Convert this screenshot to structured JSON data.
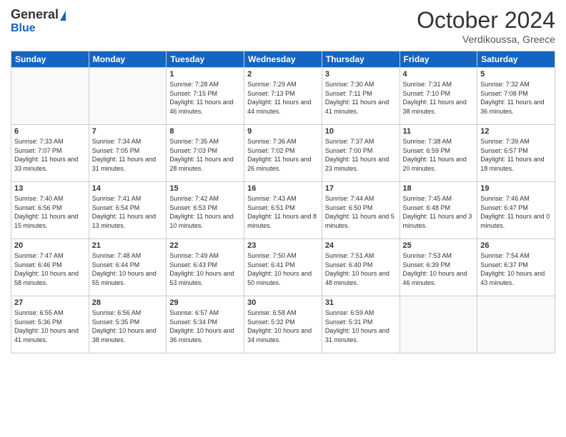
{
  "header": {
    "logo_general": "General",
    "logo_blue": "Blue",
    "month": "October 2024",
    "location": "Verdikoussa, Greece"
  },
  "weekdays": [
    "Sunday",
    "Monday",
    "Tuesday",
    "Wednesday",
    "Thursday",
    "Friday",
    "Saturday"
  ],
  "weeks": [
    [
      {
        "day": "",
        "info": ""
      },
      {
        "day": "",
        "info": ""
      },
      {
        "day": "1",
        "info": "Sunrise: 7:28 AM\nSunset: 7:15 PM\nDaylight: 11 hours and 46 minutes."
      },
      {
        "day": "2",
        "info": "Sunrise: 7:29 AM\nSunset: 7:13 PM\nDaylight: 11 hours and 44 minutes."
      },
      {
        "day": "3",
        "info": "Sunrise: 7:30 AM\nSunset: 7:11 PM\nDaylight: 11 hours and 41 minutes."
      },
      {
        "day": "4",
        "info": "Sunrise: 7:31 AM\nSunset: 7:10 PM\nDaylight: 11 hours and 38 minutes."
      },
      {
        "day": "5",
        "info": "Sunrise: 7:32 AM\nSunset: 7:08 PM\nDaylight: 11 hours and 36 minutes."
      }
    ],
    [
      {
        "day": "6",
        "info": "Sunrise: 7:33 AM\nSunset: 7:07 PM\nDaylight: 11 hours and 33 minutes."
      },
      {
        "day": "7",
        "info": "Sunrise: 7:34 AM\nSunset: 7:05 PM\nDaylight: 11 hours and 31 minutes."
      },
      {
        "day": "8",
        "info": "Sunrise: 7:35 AM\nSunset: 7:03 PM\nDaylight: 11 hours and 28 minutes."
      },
      {
        "day": "9",
        "info": "Sunrise: 7:36 AM\nSunset: 7:02 PM\nDaylight: 11 hours and 26 minutes."
      },
      {
        "day": "10",
        "info": "Sunrise: 7:37 AM\nSunset: 7:00 PM\nDaylight: 11 hours and 23 minutes."
      },
      {
        "day": "11",
        "info": "Sunrise: 7:38 AM\nSunset: 6:59 PM\nDaylight: 11 hours and 20 minutes."
      },
      {
        "day": "12",
        "info": "Sunrise: 7:39 AM\nSunset: 6:57 PM\nDaylight: 11 hours and 18 minutes."
      }
    ],
    [
      {
        "day": "13",
        "info": "Sunrise: 7:40 AM\nSunset: 6:56 PM\nDaylight: 11 hours and 15 minutes."
      },
      {
        "day": "14",
        "info": "Sunrise: 7:41 AM\nSunset: 6:54 PM\nDaylight: 11 hours and 13 minutes."
      },
      {
        "day": "15",
        "info": "Sunrise: 7:42 AM\nSunset: 6:53 PM\nDaylight: 11 hours and 10 minutes."
      },
      {
        "day": "16",
        "info": "Sunrise: 7:43 AM\nSunset: 6:51 PM\nDaylight: 11 hours and 8 minutes."
      },
      {
        "day": "17",
        "info": "Sunrise: 7:44 AM\nSunset: 6:50 PM\nDaylight: 11 hours and 5 minutes."
      },
      {
        "day": "18",
        "info": "Sunrise: 7:45 AM\nSunset: 6:48 PM\nDaylight: 11 hours and 3 minutes."
      },
      {
        "day": "19",
        "info": "Sunrise: 7:46 AM\nSunset: 6:47 PM\nDaylight: 11 hours and 0 minutes."
      }
    ],
    [
      {
        "day": "20",
        "info": "Sunrise: 7:47 AM\nSunset: 6:46 PM\nDaylight: 10 hours and 58 minutes."
      },
      {
        "day": "21",
        "info": "Sunrise: 7:48 AM\nSunset: 6:44 PM\nDaylight: 10 hours and 55 minutes."
      },
      {
        "day": "22",
        "info": "Sunrise: 7:49 AM\nSunset: 6:43 PM\nDaylight: 10 hours and 53 minutes."
      },
      {
        "day": "23",
        "info": "Sunrise: 7:50 AM\nSunset: 6:41 PM\nDaylight: 10 hours and 50 minutes."
      },
      {
        "day": "24",
        "info": "Sunrise: 7:51 AM\nSunset: 6:40 PM\nDaylight: 10 hours and 48 minutes."
      },
      {
        "day": "25",
        "info": "Sunrise: 7:53 AM\nSunset: 6:39 PM\nDaylight: 10 hours and 46 minutes."
      },
      {
        "day": "26",
        "info": "Sunrise: 7:54 AM\nSunset: 6:37 PM\nDaylight: 10 hours and 43 minutes."
      }
    ],
    [
      {
        "day": "27",
        "info": "Sunrise: 6:55 AM\nSunset: 5:36 PM\nDaylight: 10 hours and 41 minutes."
      },
      {
        "day": "28",
        "info": "Sunrise: 6:56 AM\nSunset: 5:35 PM\nDaylight: 10 hours and 38 minutes."
      },
      {
        "day": "29",
        "info": "Sunrise: 6:57 AM\nSunset: 5:34 PM\nDaylight: 10 hours and 36 minutes."
      },
      {
        "day": "30",
        "info": "Sunrise: 6:58 AM\nSunset: 5:32 PM\nDaylight: 10 hours and 34 minutes."
      },
      {
        "day": "31",
        "info": "Sunrise: 6:59 AM\nSunset: 5:31 PM\nDaylight: 10 hours and 31 minutes."
      },
      {
        "day": "",
        "info": ""
      },
      {
        "day": "",
        "info": ""
      }
    ]
  ]
}
